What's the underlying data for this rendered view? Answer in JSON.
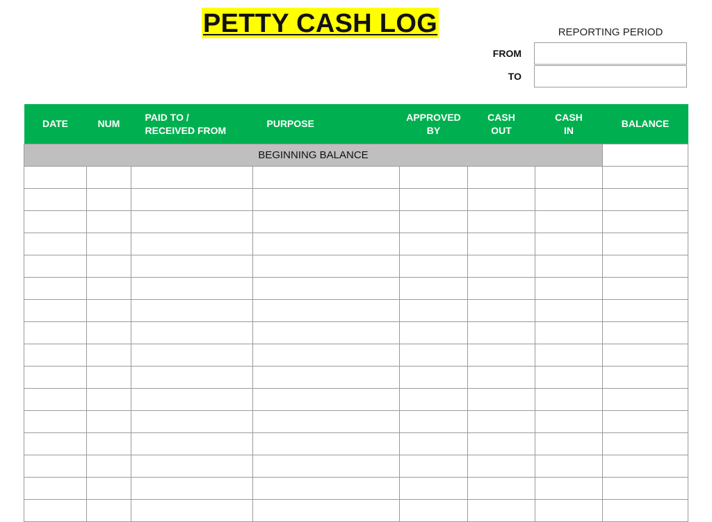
{
  "title": "PETTY CASH LOG",
  "reporting_period": {
    "heading": "REPORTING PERIOD",
    "from_label": "FROM",
    "to_label": "TO",
    "from_value": "",
    "to_value": ""
  },
  "table": {
    "columns": [
      {
        "key": "date",
        "label": "DATE"
      },
      {
        "key": "num",
        "label": "NUM"
      },
      {
        "key": "paid",
        "label": "PAID TO /\nRECEIVED FROM"
      },
      {
        "key": "purpose",
        "label": "PURPOSE"
      },
      {
        "key": "approved",
        "label": "APPROVED\nBY"
      },
      {
        "key": "out",
        "label": "CASH\nOUT"
      },
      {
        "key": "in",
        "label": "CASH\nIN"
      },
      {
        "key": "bal",
        "label": "BALANCE"
      }
    ],
    "beginning_balance_label": "BEGINNING BALANCE",
    "beginning_balance_value": "",
    "empty_row_count": 16
  },
  "colors": {
    "header_green": "#00b050",
    "title_highlight": "#ffff00",
    "beginning_row_gray": "#bfbfbf",
    "grid_line": "#9a9a9a"
  }
}
